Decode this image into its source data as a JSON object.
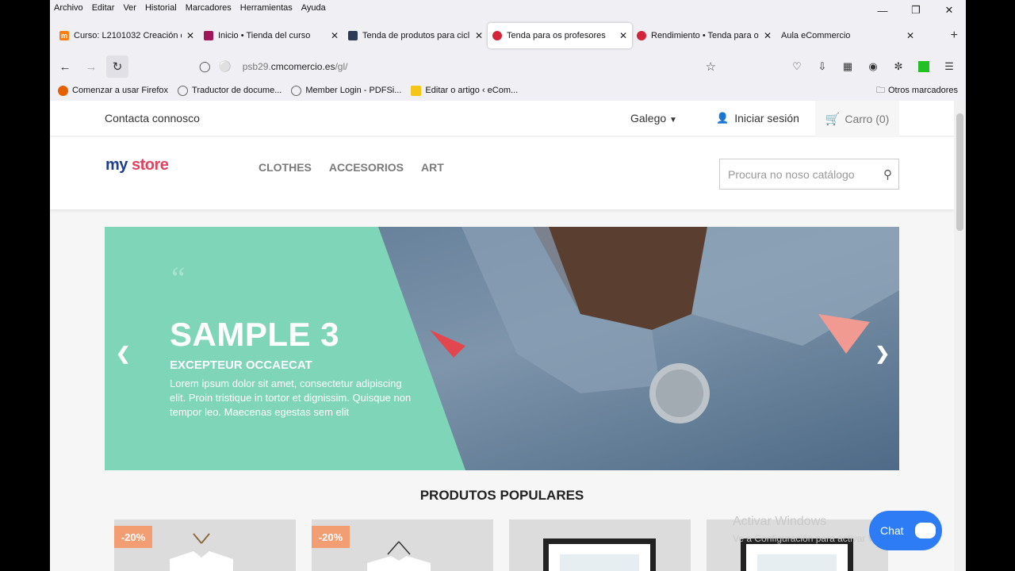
{
  "menubar": [
    "Archivo",
    "Editar",
    "Ver",
    "Historial",
    "Marcadores",
    "Herramientas",
    "Ayuda"
  ],
  "tabs": [
    {
      "title": "Curso: L2101032 Creación d",
      "fav_color": "#f98012",
      "fav_letter": "m"
    },
    {
      "title": "Inicio • Tienda del curso",
      "fav_color": "#a1165a",
      "fav_letter": ""
    },
    {
      "title": "Tenda de produtos para cicl",
      "fav_color": "#2b3a55",
      "fav_letter": ""
    },
    {
      "title": "Tenda para os profesores",
      "fav_color": "#d4243b",
      "fav_letter": ""
    },
    {
      "title": "Rendimiento • Tenda para o",
      "fav_color": "#d4243b",
      "fav_letter": ""
    },
    {
      "title": "Aula eCommercio",
      "fav_color": "",
      "fav_letter": ""
    }
  ],
  "tabs_display": {
    "last": "Aula eCommercio"
  },
  "url": {
    "host_prefix": "psb29.",
    "host": "cmcomercio.es",
    "path": "/gl/"
  },
  "bookmarks": [
    {
      "label": "Comenzar a usar Firefox",
      "color": "#e66000"
    },
    {
      "label": "Traductor de docume...",
      "color": "#666"
    },
    {
      "label": "Member Login - PDFSi...",
      "color": "#666"
    },
    {
      "label": "Editar o artigo ‹ eCom...",
      "color": "#f5c518"
    }
  ],
  "other_bookmarks": "Otros marcadores",
  "header": {
    "contact": "Contacta connosco",
    "language": "Galego",
    "login": "Iniciar sesión",
    "cart": "Carro (0)"
  },
  "logo": {
    "part1": "my",
    "part2": "store"
  },
  "nav": [
    "CLOTHES",
    "ACCESORIOS",
    "ART"
  ],
  "search": {
    "placeholder": "Procura no noso catálogo"
  },
  "slide": {
    "title": "SAMPLE 3",
    "subtitle": "EXCEPTEUR OCCAECAT",
    "body": "Lorem ipsum dolor sit amet, consectetur adipiscing elit. Proin tristique in tortor et dignissim. Quisque non tempor leo. Maecenas egestas sem elit"
  },
  "popular": {
    "title": "PRODUTOS POPULARES",
    "discounts": [
      "-20%",
      "-20%"
    ]
  },
  "watermark": {
    "line1": "Activar Windows",
    "line2": "Ve a Configuración para activar Windows."
  },
  "chat": {
    "label": "Chat"
  },
  "colors": {
    "accent_green": "#7fd5b8",
    "discount": "#f39d72",
    "chat": "#2e7bf6"
  }
}
